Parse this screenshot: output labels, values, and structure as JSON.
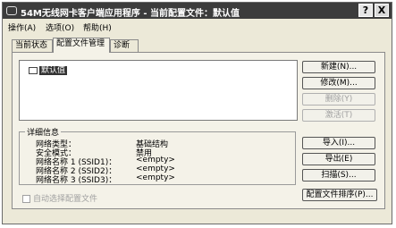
{
  "window": {
    "title": "54M无线网卡客户端应用程序 - 当前配置文件：默认值",
    "help_button": "?",
    "close_button": "X"
  },
  "menubar": [
    "操作(A)",
    "选项(O)",
    "帮助(H)"
  ],
  "tabs": [
    "当前状态",
    "配置文件管理",
    "诊断"
  ],
  "profiles": {
    "items": [
      "默认值"
    ]
  },
  "buttons": {
    "new": "新建(N)...",
    "modify": "修改(M)...",
    "remove": "删除(Y)",
    "activate": "激活(T)",
    "import": "导入(I)...",
    "export": "导出(E)",
    "scan": "扫描(S)...",
    "order_profiles": "配置文件排序(P)..."
  },
  "details": {
    "title": "详细信息",
    "rows": [
      {
        "label": "网络类型：",
        "value": "基础结构"
      },
      {
        "label": "安全模式：",
        "value": "禁用"
      },
      {
        "label": "网络名称 1 (SSID1)：",
        "value": "<empty>"
      },
      {
        "label": "网络名称 2 (SSID2)：",
        "value": "<empty>"
      },
      {
        "label": "网络名称 3 (SSID3)：",
        "value": "<empty>"
      }
    ]
  },
  "auto_select": {
    "label": "自动选择配置文件",
    "checked": false
  }
}
